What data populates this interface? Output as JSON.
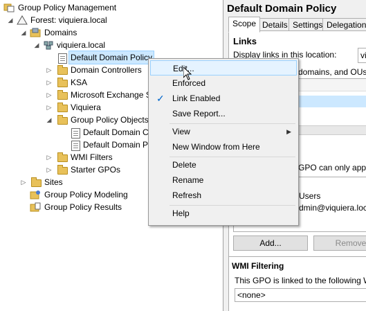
{
  "tree": {
    "root": "Group Policy Management",
    "forest": "Forest: viquiera.local",
    "domains": "Domains",
    "domain": "viquiera.local",
    "selected": "Default Domain Policy",
    "domain_children": [
      "Domain Controllers",
      "KSA",
      "Microsoft Exchange S",
      "Viquiera"
    ],
    "gpo_container": "Group Policy Objects",
    "gpo_items": [
      "Default Domain C",
      "Default Domain P"
    ],
    "wmi": "WMI Filters",
    "starter": "Starter GPOs",
    "sites": "Sites",
    "modeling": "Group Policy Modeling",
    "results": "Group Policy Results"
  },
  "right": {
    "title": "Default Domain Policy",
    "tabs": [
      "Scope",
      "Details",
      "Settings",
      "Delegation"
    ],
    "links_heading": "Links",
    "display_links": "Display links in this location:",
    "display_value": "vi",
    "desc_fragment": "domains, and OUs are",
    "security_fragment": "GPO can only apply to",
    "users_fragment": "Users",
    "admin_fragment": "dmin@viquiera.local)",
    "add_button": "Add...",
    "remove_button": "Remove",
    "wmi_heading": "WMI Filtering",
    "wmi_desc": "This GPO is linked to the following WMI",
    "wmi_value": "<none>"
  },
  "menu": {
    "items": {
      "edit": "Edit...",
      "enforced": "Enforced",
      "link_enabled": "Link Enabled",
      "save_report": "Save Report...",
      "view": "View",
      "new_window": "New Window from Here",
      "delete": "Delete",
      "rename": "Rename",
      "refresh": "Refresh",
      "help": "Help"
    },
    "checked_item": "Link Enabled"
  },
  "colors": {
    "selection": "#cce8ff",
    "menu_hover": "#e5f3ff",
    "check": "#0066cc"
  },
  "icons": [
    "folder-icon",
    "gpo-icon",
    "forest-icon",
    "domain-icon",
    "checkmark-icon",
    "submenu-arrow-icon",
    "cursor-icon"
  ]
}
